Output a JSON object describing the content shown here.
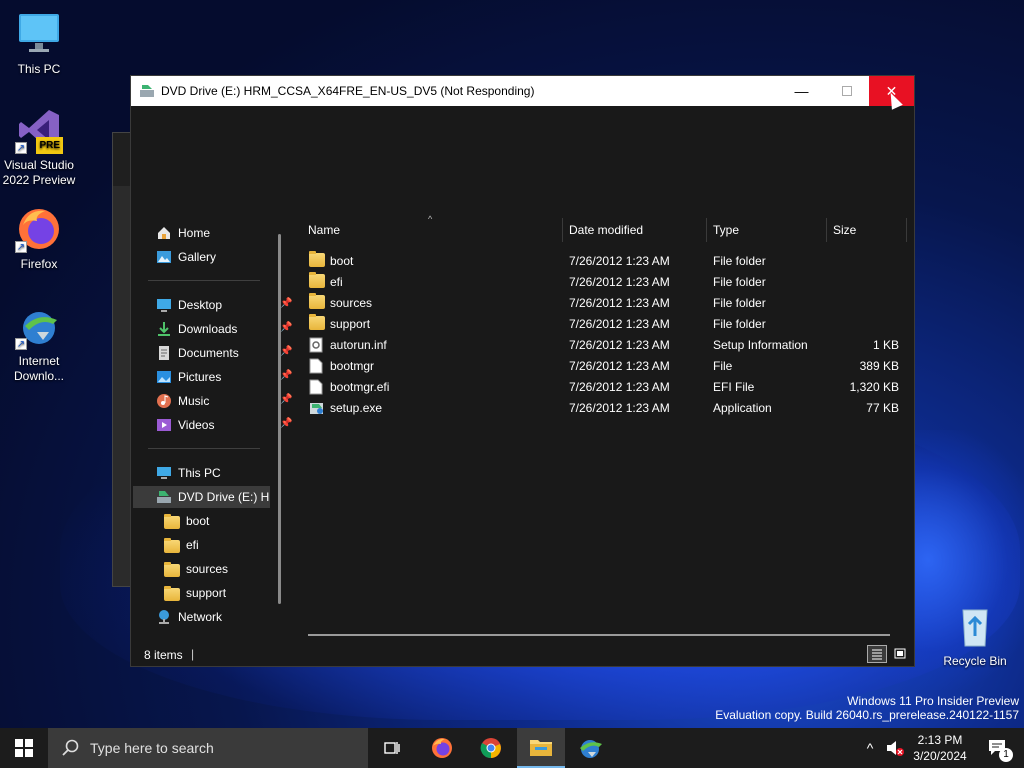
{
  "desktop": {
    "icons": [
      {
        "label": "This PC"
      },
      {
        "label": "Visual Studio 2022 Preview"
      },
      {
        "label": "Firefox"
      },
      {
        "label": "Internet Downlo..."
      },
      {
        "label": "Recycle Bin"
      }
    ],
    "vs_badge": "PRE",
    "watermark_line1": "Windows 11 Pro Insider Preview",
    "watermark_line2": "Evaluation copy. Build 26040.rs_prerelease.240122-1157"
  },
  "window": {
    "title": "DVD Drive (E:) HRM_CCSA_X64FRE_EN-US_DV5 (Not Responding)",
    "minimize_glyph": "—",
    "close_glyph": "✕"
  },
  "nav": {
    "home": "Home",
    "gallery": "Gallery",
    "quick": [
      {
        "label": "Desktop",
        "icon": "desktop-icon"
      },
      {
        "label": "Downloads",
        "icon": "download-icon"
      },
      {
        "label": "Documents",
        "icon": "documents-icon"
      },
      {
        "label": "Pictures",
        "icon": "pictures-icon"
      },
      {
        "label": "Music",
        "icon": "music-icon"
      },
      {
        "label": "Videos",
        "icon": "videos-icon"
      }
    ],
    "pin_glyph": "📌",
    "this_pc": "This PC",
    "dvd": "DVD Drive (E:) HR",
    "subfolders": [
      "boot",
      "efi",
      "sources",
      "support"
    ],
    "network": "Network"
  },
  "columns": {
    "name": "Name",
    "date": "Date modified",
    "type": "Type",
    "size": "Size"
  },
  "files": [
    {
      "name": "boot",
      "date": "7/26/2012 1:23 AM",
      "type": "File folder",
      "size": "",
      "kind": "folder"
    },
    {
      "name": "efi",
      "date": "7/26/2012 1:23 AM",
      "type": "File folder",
      "size": "",
      "kind": "folder"
    },
    {
      "name": "sources",
      "date": "7/26/2012 1:23 AM",
      "type": "File folder",
      "size": "",
      "kind": "folder"
    },
    {
      "name": "support",
      "date": "7/26/2012 1:23 AM",
      "type": "File folder",
      "size": "",
      "kind": "folder"
    },
    {
      "name": "autorun.inf",
      "date": "7/26/2012 1:23 AM",
      "type": "Setup Information",
      "size": "1 KB",
      "kind": "inf"
    },
    {
      "name": "bootmgr",
      "date": "7/26/2012 1:23 AM",
      "type": "File",
      "size": "389 KB",
      "kind": "file"
    },
    {
      "name": "bootmgr.efi",
      "date": "7/26/2012 1:23 AM",
      "type": "EFI File",
      "size": "1,320 KB",
      "kind": "file"
    },
    {
      "name": "setup.exe",
      "date": "7/26/2012 1:23 AM",
      "type": "Application",
      "size": "77 KB",
      "kind": "exe"
    }
  ],
  "status": {
    "items": "8 items",
    "separator": "|"
  },
  "taskbar": {
    "search_placeholder": "Type here to search",
    "time": "2:13 PM",
    "date": "3/20/2024",
    "notification_count": "1",
    "chevron": "^"
  },
  "colors": {
    "accent": "#0078d4",
    "close_red": "#e81123",
    "window_bg": "#191919"
  }
}
